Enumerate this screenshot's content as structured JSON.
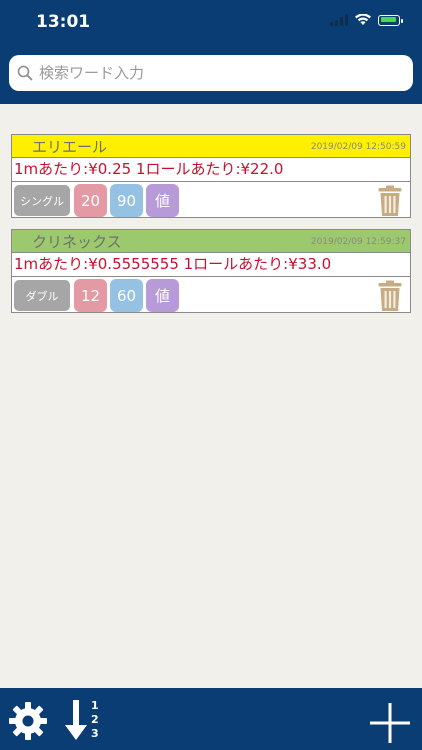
{
  "status_bar": {
    "time": "13:01"
  },
  "search": {
    "placeholder": "検索ワード入力"
  },
  "items": [
    {
      "name": "エリエール",
      "date": "2019/02/09 12:50:59",
      "price_text": "1mあたり:¥0.25 1ロールあたり:¥22.0",
      "type_label": "シングル",
      "length": "20",
      "rolls": "90",
      "price_label": "値",
      "color": "#fff000"
    },
    {
      "name": "クリネックス",
      "date": "2019/02/09 12:59:37",
      "price_text": "1mあたり:¥0.5555555 1ロールあたり:¥33.0",
      "type_label": "ダブル",
      "length": "12",
      "rolls": "60",
      "price_label": "値",
      "color": "#9cc96d"
    }
  ],
  "footer": {
    "sort_numbers": [
      "1",
      "2",
      "3"
    ]
  },
  "icons": {
    "settings": "gear-icon",
    "sort": "sort-icon",
    "add": "plus-icon",
    "delete": "trash-icon",
    "search": "search-icon"
  },
  "colors": {
    "header": "#0a3d73",
    "price_text": "#c8102e",
    "length_btn": "#e39aa5",
    "rolls_btn": "#95c2e3",
    "price_btn": "#b79ad8"
  }
}
